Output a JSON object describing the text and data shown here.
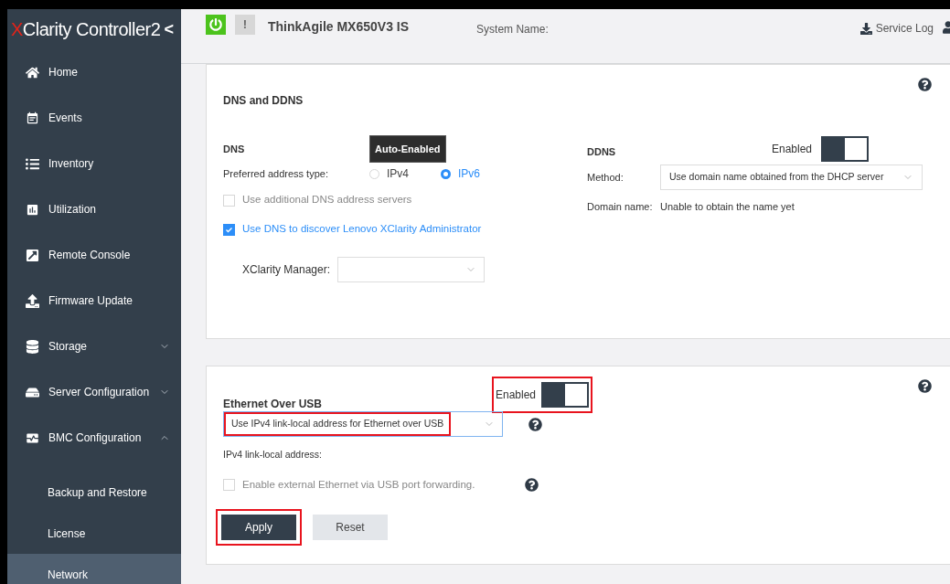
{
  "sidebar": {
    "logo_mark": "X",
    "logo_text": "Clarity",
    "logo_product": "Controller2",
    "collapse": "<",
    "items": [
      {
        "kind": "item",
        "label": "Home"
      },
      {
        "kind": "item",
        "label": "Events"
      },
      {
        "kind": "item",
        "label": "Inventory"
      },
      {
        "kind": "item",
        "label": "Utilization"
      },
      {
        "kind": "item",
        "label": "Remote Console"
      },
      {
        "kind": "item",
        "label": "Firmware Update"
      },
      {
        "kind": "group",
        "label": "Storage",
        "expanded": false
      },
      {
        "kind": "group",
        "label": "Server Configuration",
        "expanded": false
      },
      {
        "kind": "group",
        "label": "BMC Configuration",
        "expanded": true,
        "children": [
          {
            "label": "Backup and Restore",
            "selected": false
          },
          {
            "label": "License",
            "selected": false
          },
          {
            "label": "Network",
            "selected": true
          }
        ]
      }
    ]
  },
  "header": {
    "warning": "!",
    "system_model": "ThinkAgile MX650V3 IS",
    "system_name_label": "System Name:",
    "service_log": "Service Log"
  },
  "dns_card": {
    "title": "DNS and DDNS",
    "dns": {
      "heading": "DNS",
      "badge": "Auto-Enabled",
      "preferred_label": "Preferred address type:",
      "options": [
        {
          "label": "IPv4",
          "selected": false
        },
        {
          "label": "IPv6",
          "selected": true
        }
      ],
      "checkboxes": [
        {
          "label": "Use additional DNS address servers",
          "checked": false
        },
        {
          "label": "Use DNS to discover Lenovo XClarity Administrator",
          "checked": true
        }
      ],
      "manager_label": "XClarity Manager:"
    },
    "ddns": {
      "heading": "DDNS",
      "toggle_label": "Enabled",
      "on": true,
      "method_label": "Method:",
      "method_value": "Use domain name obtained from the DHCP server",
      "domain_label": "Domain name:",
      "domain_value": "Unable to obtain the name yet"
    }
  },
  "usb_card": {
    "title": "Ethernet Over USB",
    "toggle_label": "Enabled",
    "on": true,
    "toggle_highlighted": true,
    "mode_value": "Use IPv4 link-local address for Ethernet over USB",
    "mode_highlighted": true,
    "address_label": "IPv4 link-local address:",
    "forwarding": {
      "label": "Enable external Ethernet via USB port forwarding.",
      "checked": false
    },
    "buttons": [
      {
        "kind": "primary",
        "label": "Apply",
        "highlighted": true
      },
      {
        "kind": "secondary",
        "label": "Reset",
        "highlighted": false
      }
    ]
  }
}
